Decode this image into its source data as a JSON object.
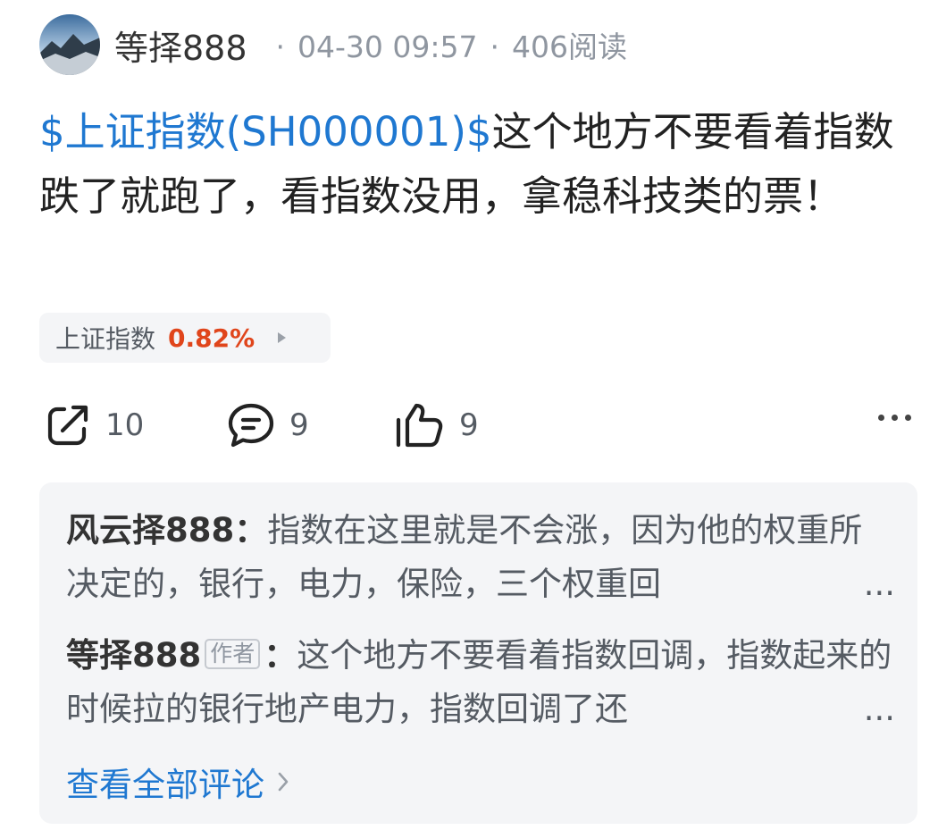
{
  "header": {
    "author_name": "等择888",
    "dot": "·",
    "timestamp": "04-30 09:57",
    "read_count": "406阅读"
  },
  "post": {
    "stock_link": "$上证指数(SH000001)$",
    "body": "这个地方不要看着指数跌了就跑了，看指数没用，拿稳科技类的票！"
  },
  "stock_chip": {
    "name": "上证指数",
    "change": "0.82%"
  },
  "actions": {
    "share_count": "10",
    "comment_count": "9",
    "like_count": "9"
  },
  "comments": [
    {
      "name": "风云择888",
      "separator": "：",
      "text": "指数在这里就是不会涨，因为他的权重所决定的，银行，电力，保险，三个权重回",
      "ellipsis": "..."
    },
    {
      "name": "等择888",
      "author_tag": "作者",
      "separator": "：",
      "text": "这个地方不要看着指数回调，指数起来的时候拉的银行地产电力，指数回调了还",
      "ellipsis": "..."
    }
  ],
  "view_all_label": "查看全部评论",
  "colors": {
    "link": "#1f78d1",
    "change_up": "#e0451b",
    "panel_bg": "#f4f5f7",
    "meta_gray": "#8f96a0"
  },
  "icons": [
    "share-icon",
    "comment-icon",
    "like-icon",
    "more-icon",
    "chevron-right-icon"
  ]
}
